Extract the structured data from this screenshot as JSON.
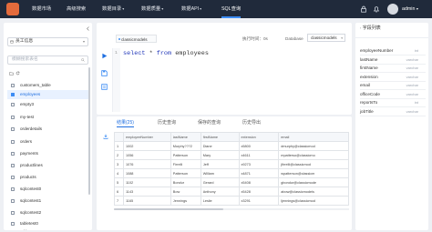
{
  "topbar": {
    "nav": [
      {
        "label": "数据市场",
        "caret": ""
      },
      {
        "label": "高级搜索",
        "caret": ""
      },
      {
        "label": "数据目录",
        "caret": "▾"
      },
      {
        "label": "数据质量",
        "caret": "▾"
      },
      {
        "label": "数据API",
        "caret": "▾"
      },
      {
        "label": "SQL查询",
        "caret": ""
      }
    ],
    "user": "admin"
  },
  "left": {
    "datasource": "员工信息",
    "search_placeholder": "模糊搜索表名",
    "tables": [
      "customers_table",
      "employees",
      "empty3",
      "my-test",
      "orderdetails",
      "orders",
      "payments",
      "productlines",
      "products",
      "sqlcontest0",
      "sqlcontest1",
      "sqlcontest2",
      "tabletest0",
      "tabletest1"
    ]
  },
  "editor": {
    "db_tab": "classicmodels",
    "exec_time": "执行时间：0s",
    "db_label": "Database",
    "db_value": "classicmodels",
    "line_no": "1",
    "sql": {
      "kw1": "select",
      "star": "*",
      "kw2": "from",
      "table": "employees"
    }
  },
  "results": {
    "tabs": [
      "结果(25)",
      "历史查询",
      "保存的查询",
      "历史导出"
    ],
    "columns": [
      "",
      "employeeNumber",
      "lastName",
      "firstName",
      "extension",
      "email"
    ],
    "rows": [
      [
        "1",
        "1002",
        "Murphy???2",
        "Diane",
        "x5800",
        "dmurphy@classicmod"
      ],
      [
        "2",
        "1056",
        "Patterson",
        "Mary",
        "x4611",
        "mpatterso@classicmo"
      ],
      [
        "3",
        "1076",
        "Firrelli",
        "Jeff",
        "x9273",
        "jfirrelli@classicmod"
      ],
      [
        "4",
        "1088",
        "Patterson",
        "William",
        "x4871",
        "wpatterson@classicm"
      ],
      [
        "5",
        "1102",
        "Bondur",
        "Gerard",
        "x5408",
        "gbondur@classicmode"
      ],
      [
        "6",
        "1143",
        "Bow",
        "Anthony",
        "x5428",
        "abow@classicmodels"
      ],
      [
        "7",
        "1165",
        "Jennings",
        "Leslie",
        "x3291",
        "ljennings@classicmod"
      ]
    ]
  },
  "right": {
    "title": "字段列表",
    "fields": [
      {
        "name": "employeeNumber",
        "type": "int"
      },
      {
        "name": "lastName",
        "type": "varchar"
      },
      {
        "name": "firstName",
        "type": "varchar"
      },
      {
        "name": "extension",
        "type": "varchar"
      },
      {
        "name": "email",
        "type": "varchar"
      },
      {
        "name": "officeCode",
        "type": "varchar"
      },
      {
        "name": "reportsTo",
        "type": "int"
      },
      {
        "name": "jobTitle",
        "type": "varchar"
      }
    ]
  },
  "colors": {
    "topbar": "#202a3b",
    "accent": "#3c8cf4",
    "brand": "#e46b3c"
  }
}
